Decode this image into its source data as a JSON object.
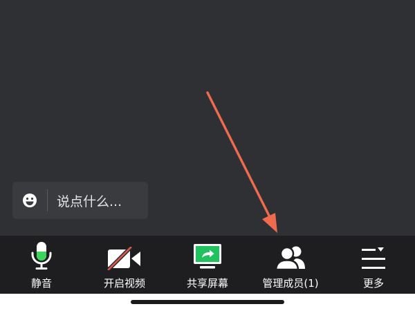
{
  "chat": {
    "placeholder": "说点什么..."
  },
  "toolbar": {
    "items": [
      {
        "label": "静音",
        "icon": "microphone-icon",
        "accent": "#3dd45b"
      },
      {
        "label": "开启视频",
        "icon": "video-off-icon",
        "accent": "#e2554f"
      },
      {
        "label": "共享屏幕",
        "icon": "share-screen-icon",
        "accent": "#1fc25d"
      },
      {
        "label": "管理成员(1)",
        "icon": "members-icon"
      },
      {
        "label": "更多",
        "icon": "more-menu-icon"
      }
    ]
  },
  "colors": {
    "background": "#2f3033",
    "toolbar": "#1e1e20",
    "annotation_arrow": "#ee6b4d"
  }
}
